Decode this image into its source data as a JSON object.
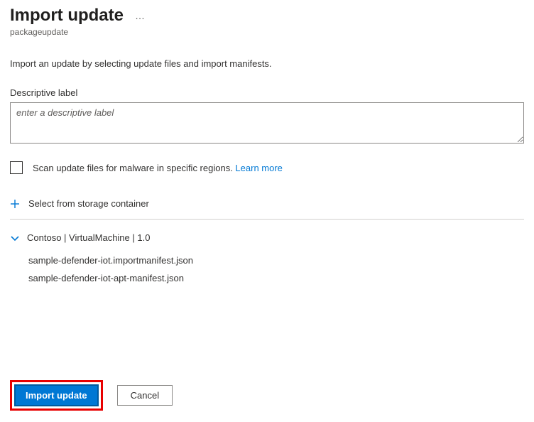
{
  "header": {
    "title": "Import update",
    "subtitle": "packageupdate"
  },
  "description": "Import an update by selecting update files and import manifests.",
  "label_field": {
    "label": "Descriptive label",
    "placeholder": "enter a descriptive label",
    "value": ""
  },
  "scan_checkbox": {
    "label": "Scan update files for malware in specific regions. ",
    "link": "Learn more",
    "checked": false
  },
  "storage_action": {
    "label": "Select from storage container"
  },
  "update_group": {
    "title": "Contoso | VirtualMachine | 1.0",
    "files": [
      "sample-defender-iot.importmanifest.json",
      "sample-defender-iot-apt-manifest.json"
    ]
  },
  "footer": {
    "primary": "Import update",
    "secondary": "Cancel"
  }
}
